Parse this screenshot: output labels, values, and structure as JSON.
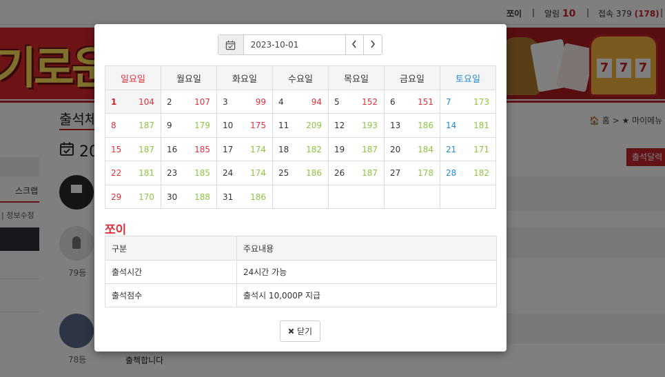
{
  "topbar": {
    "username": "쪼이",
    "alarm_label": "알림",
    "alarm_count": "10",
    "connect_label": "접속 379",
    "connect_count": "(178)",
    "separator": "|"
  },
  "banner": {
    "text": "기로운"
  },
  "background_page": {
    "title": "출석체",
    "calendar_title": "20",
    "breadcrumb": "🏠 홈 > ★ 마이메뉴",
    "calendar_button": "출석달력",
    "sidebar_scrap": "스크랩",
    "sidebar_info": "| 정보수정",
    "ranks": [
      "79등",
      "78등"
    ],
    "post_text": "출첵합니다"
  },
  "modal": {
    "date_value": "2023-10-01",
    "weekdays": [
      "일요일",
      "월요일",
      "화요일",
      "수요일",
      "목요일",
      "금요일",
      "토요일"
    ],
    "weeks": [
      [
        {
          "d": "1",
          "n": "104",
          "c": "red"
        },
        {
          "d": "2",
          "n": "107",
          "c": "red"
        },
        {
          "d": "3",
          "n": "99",
          "c": "red"
        },
        {
          "d": "4",
          "n": "94",
          "c": "red"
        },
        {
          "d": "5",
          "n": "152",
          "c": "red"
        },
        {
          "d": "6",
          "n": "151",
          "c": "red"
        },
        {
          "d": "7",
          "n": "173",
          "c": "green"
        }
      ],
      [
        {
          "d": "8",
          "n": "187",
          "c": "green"
        },
        {
          "d": "9",
          "n": "179",
          "c": "green"
        },
        {
          "d": "10",
          "n": "175",
          "c": "red"
        },
        {
          "d": "11",
          "n": "209",
          "c": "green"
        },
        {
          "d": "12",
          "n": "193",
          "c": "green"
        },
        {
          "d": "13",
          "n": "186",
          "c": "green"
        },
        {
          "d": "14",
          "n": "181",
          "c": "green"
        }
      ],
      [
        {
          "d": "15",
          "n": "187",
          "c": "green"
        },
        {
          "d": "16",
          "n": "185",
          "c": "red"
        },
        {
          "d": "17",
          "n": "174",
          "c": "green"
        },
        {
          "d": "18",
          "n": "182",
          "c": "green"
        },
        {
          "d": "19",
          "n": "187",
          "c": "green"
        },
        {
          "d": "20",
          "n": "184",
          "c": "green"
        },
        {
          "d": "21",
          "n": "171",
          "c": "green"
        }
      ],
      [
        {
          "d": "22",
          "n": "181",
          "c": "green"
        },
        {
          "d": "23",
          "n": "185",
          "c": "green"
        },
        {
          "d": "24",
          "n": "174",
          "c": "green"
        },
        {
          "d": "25",
          "n": "186",
          "c": "green"
        },
        {
          "d": "26",
          "n": "187",
          "c": "green"
        },
        {
          "d": "27",
          "n": "178",
          "c": "green"
        },
        {
          "d": "28",
          "n": "182",
          "c": "green"
        }
      ],
      [
        {
          "d": "29",
          "n": "170",
          "c": "green"
        },
        {
          "d": "30",
          "n": "188",
          "c": "green"
        },
        {
          "d": "31",
          "n": "186",
          "c": "green"
        },
        {
          "d": "",
          "n": "",
          "c": ""
        },
        {
          "d": "",
          "n": "",
          "c": ""
        },
        {
          "d": "",
          "n": "",
          "c": ""
        },
        {
          "d": "",
          "n": "",
          "c": ""
        }
      ]
    ],
    "user_name": "쪼이",
    "info_headers": [
      "구분",
      "주요내용"
    ],
    "info_rows": [
      [
        "출석시간",
        "24시간 가능"
      ],
      [
        "출석점수",
        "출석시 10,000P 지급"
      ]
    ],
    "close_label": "닫기",
    "colors": {
      "accent": "#c7252b",
      "sunday": "#e2303a",
      "saturday": "#1f8dd6",
      "count_green": "#8cc63f",
      "count_red": "#e2303a"
    },
    "icons": {
      "calendar": "calendar-check-icon",
      "prev": "chevron-left-icon",
      "next": "chevron-right-icon",
      "close": "times-icon"
    }
  }
}
